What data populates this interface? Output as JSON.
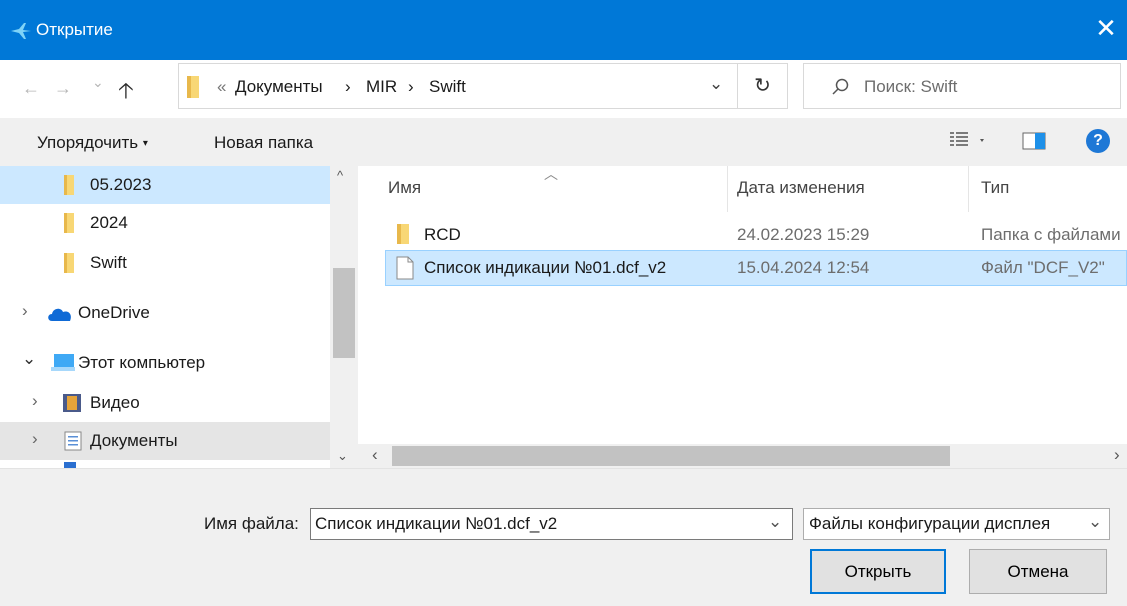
{
  "window": {
    "title": "Открытие",
    "close_glyph": "✕",
    "accent": "#0078d7"
  },
  "nav": {
    "back_glyph": "←",
    "forward_glyph": "→",
    "recent_glyph": "⌄",
    "up_glyph": "🡡",
    "overflow_glyph": "«",
    "breadcrumb": [
      "Документы",
      "MIR",
      "Swift"
    ],
    "separator_glyph": "›",
    "refresh_glyph": "↻",
    "dropdown_glyph": "⌄",
    "search_placeholder": "Поиск: Swift",
    "search_glyph": "⌕"
  },
  "toolbar": {
    "organize_label": "Упорядочить",
    "new_folder_label": "Новая папка",
    "help_glyph": "?"
  },
  "sidebar": {
    "items": [
      {
        "label": "05.2023",
        "icon": "folder-icon"
      },
      {
        "label": "2024",
        "icon": "folder-icon"
      },
      {
        "label": "Swift",
        "icon": "folder-icon"
      },
      {
        "label": "OneDrive",
        "icon": "cloud-icon"
      },
      {
        "label": "Этот компьютер",
        "icon": "computer-icon"
      },
      {
        "label": "Видео",
        "icon": "video-icon"
      },
      {
        "label": "Документы",
        "icon": "documents-icon"
      }
    ],
    "expand_glyph": "›",
    "expanded_glyph": "⌄"
  },
  "columns": {
    "name": "Имя",
    "date": "Дата изменения",
    "type": "Тип",
    "sort_glyph": "︿"
  },
  "files": [
    {
      "name": "RCD",
      "date": "24.02.2023 15:29",
      "type": "Папка с файлами",
      "icon": "folder-icon"
    },
    {
      "name": "Список индикации №01.dcf_v2",
      "date": "15.04.2024 12:54",
      "type": "Файл \"DCF_V2\"",
      "icon": "file-icon"
    }
  ],
  "bottom": {
    "filename_label": "Имя файла:",
    "filename_value": "Список индикации №01.dcf_v2",
    "filetype_value": "Файлы конфигурации дисплея",
    "open_label": "Открыть",
    "cancel_label": "Отмена",
    "chevron_glyph": "⌄"
  },
  "scroll": {
    "up_glyph": "^",
    "down_glyph": "⌄",
    "left_glyph": "‹",
    "right_glyph": "›"
  }
}
